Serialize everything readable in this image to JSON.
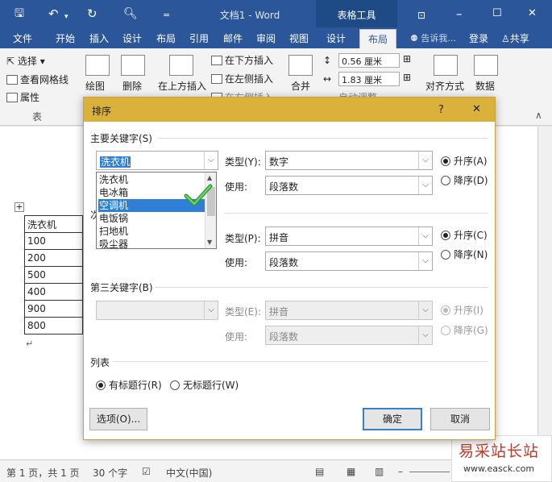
{
  "titlebar": {
    "doc_title": "文档1 - Word",
    "context_title": "表格工具",
    "save_icon": "save-icon",
    "undo_icon": "undo-icon",
    "redo_icon": "redo-icon",
    "preview_icon": "print-preview-icon",
    "qat_icon": "customize-qat-icon",
    "ribbon_opt": "⊡",
    "minimize": "–",
    "restore": "☐",
    "close": "✕"
  },
  "tabs": [
    "文件",
    "开始",
    "插入",
    "设计",
    "布局",
    "引用",
    "邮件",
    "审阅",
    "视图",
    "设计",
    "布局"
  ],
  "tellme": "告诉我...",
  "login": "登录",
  "share": "共享",
  "ribbon": {
    "select": "选择",
    "gridlines": "查看网格线",
    "properties": "属性",
    "group_table": "表",
    "draw": "绘图",
    "delete": "删除",
    "insert_above": "在上方插入",
    "insert_below": "在下方插入",
    "insert_left": "在左侧插入",
    "insert_right": "在右侧插入",
    "merge": "合并",
    "height": "0.56 厘米",
    "width": "1.83 厘米",
    "autofit": "自动调整",
    "align": "对齐方式",
    "data": "数据"
  },
  "document": {
    "rows": [
      "洗衣机",
      "100",
      "200",
      "500",
      "400",
      "900",
      "800"
    ],
    "para_mark": "↵"
  },
  "dialog": {
    "title": "排序",
    "help": "?",
    "close": "✕",
    "primary_key_label": "主要关键字(S)",
    "primary_value": "洗衣机",
    "type_label": "类型(Y):",
    "type_value": "数字",
    "using_label": "使用:",
    "using_value": "段落数",
    "asc_label": "升序(A)",
    "desc_label": "降序(D)",
    "secondary_label_partial": "次",
    "type2_label": "类型(P):",
    "type2_value": "拼音",
    "using2_label": "使用:",
    "using2_value": "段落数",
    "asc2_label": "升序(C)",
    "desc2_label": "降序(N)",
    "third_key_label": "第三关键字(B)",
    "type3_label": "类型(E):",
    "type3_value": "拼音",
    "using3_label": "使用:",
    "using3_value": "段落数",
    "asc3_label": "升序(I)",
    "desc3_label": "降序(G)",
    "list_label": "列表",
    "header_yes": "有标题行(R)",
    "header_no": "无标题行(W)",
    "options_btn": "选项(O)...",
    "ok_btn": "确定",
    "cancel_btn": "取消",
    "dropdown_options": [
      "洗衣机",
      "电冰箱",
      "空调机",
      "电饭锅",
      "扫地机",
      "吸尘器"
    ],
    "dropdown_highlight": "空调机"
  },
  "status": {
    "page": "第 1 页，共 1 页",
    "words": "30 个字",
    "lang": "中文(中国)"
  },
  "watermark": {
    "title": "易采站长站",
    "url": "www.easck.com"
  },
  "colors": {
    "title_blue": "#2b579a",
    "dialog_gold": "#d9b13b",
    "highlight_blue": "#2f7fd6",
    "check_green": "#2e9e38"
  }
}
